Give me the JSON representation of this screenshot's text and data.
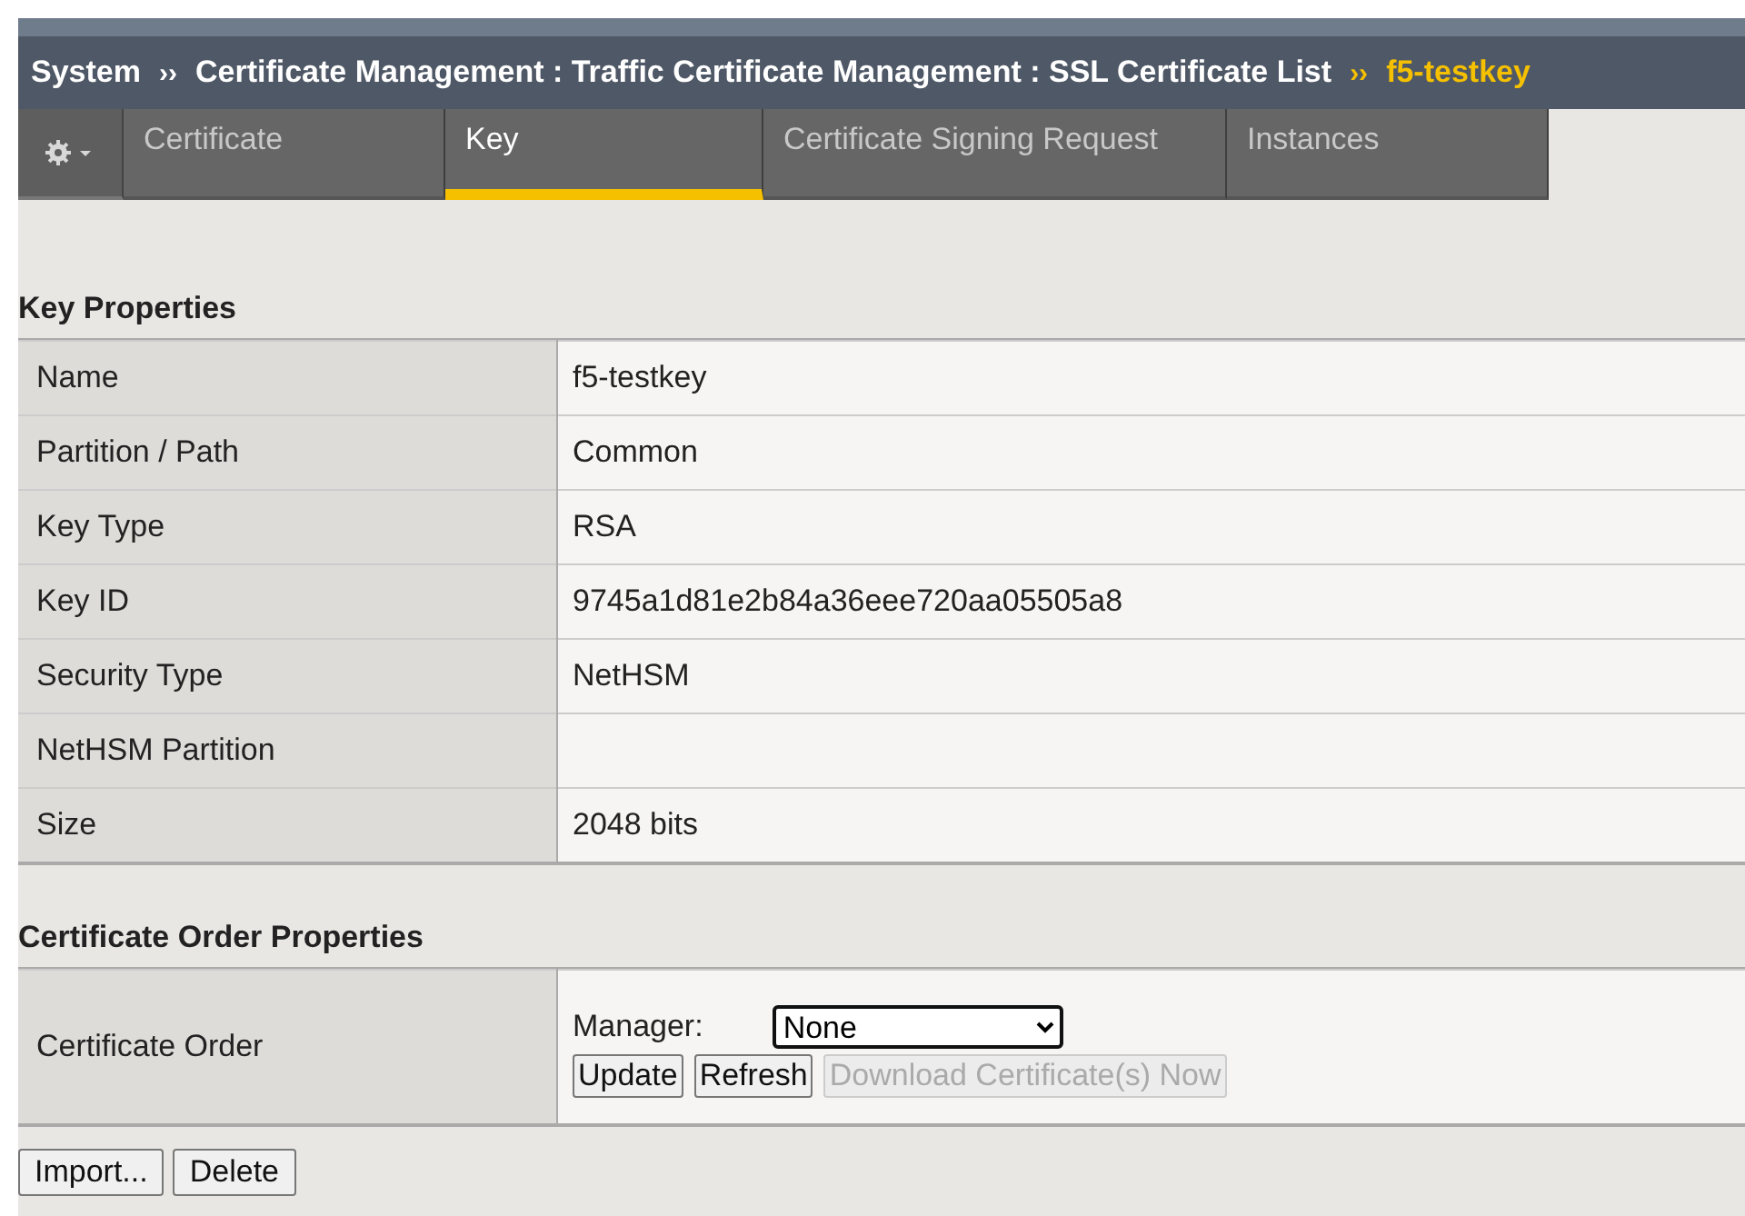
{
  "breadcrumb": {
    "items": [
      {
        "label": "System",
        "current": false
      },
      {
        "label": "Certificate Management : Traffic Certificate Management : SSL Certificate List",
        "current": false
      },
      {
        "label": "f5-testkey",
        "current": true
      }
    ],
    "separator": "››"
  },
  "tabs": [
    {
      "label": "Certificate",
      "selected": false
    },
    {
      "label": "Key",
      "selected": true
    },
    {
      "label": "Certificate Signing Request",
      "selected": false
    },
    {
      "label": "Instances",
      "selected": false
    }
  ],
  "key_properties": {
    "title": "Key Properties",
    "rows": [
      {
        "label": "Name",
        "value": "f5-testkey"
      },
      {
        "label": "Partition / Path",
        "value": "Common"
      },
      {
        "label": "Key Type",
        "value": "RSA"
      },
      {
        "label": "Key ID",
        "value": "9745a1d81e2b84a36eee720aa05505a8"
      },
      {
        "label": "Security Type",
        "value": "NetHSM"
      },
      {
        "label": "NetHSM Partition",
        "value": ""
      },
      {
        "label": "Size",
        "value": "2048 bits"
      }
    ]
  },
  "order_properties": {
    "title": "Certificate Order Properties",
    "label": "Certificate Order",
    "manager_label": "Manager:",
    "manager_value": "None",
    "buttons": [
      {
        "label": "Update",
        "disabled": false
      },
      {
        "label": "Refresh",
        "disabled": false
      },
      {
        "label": "Download Certificate(s) Now",
        "disabled": true
      }
    ]
  },
  "actions": [
    {
      "label": "Import..."
    },
    {
      "label": "Delete"
    }
  ]
}
